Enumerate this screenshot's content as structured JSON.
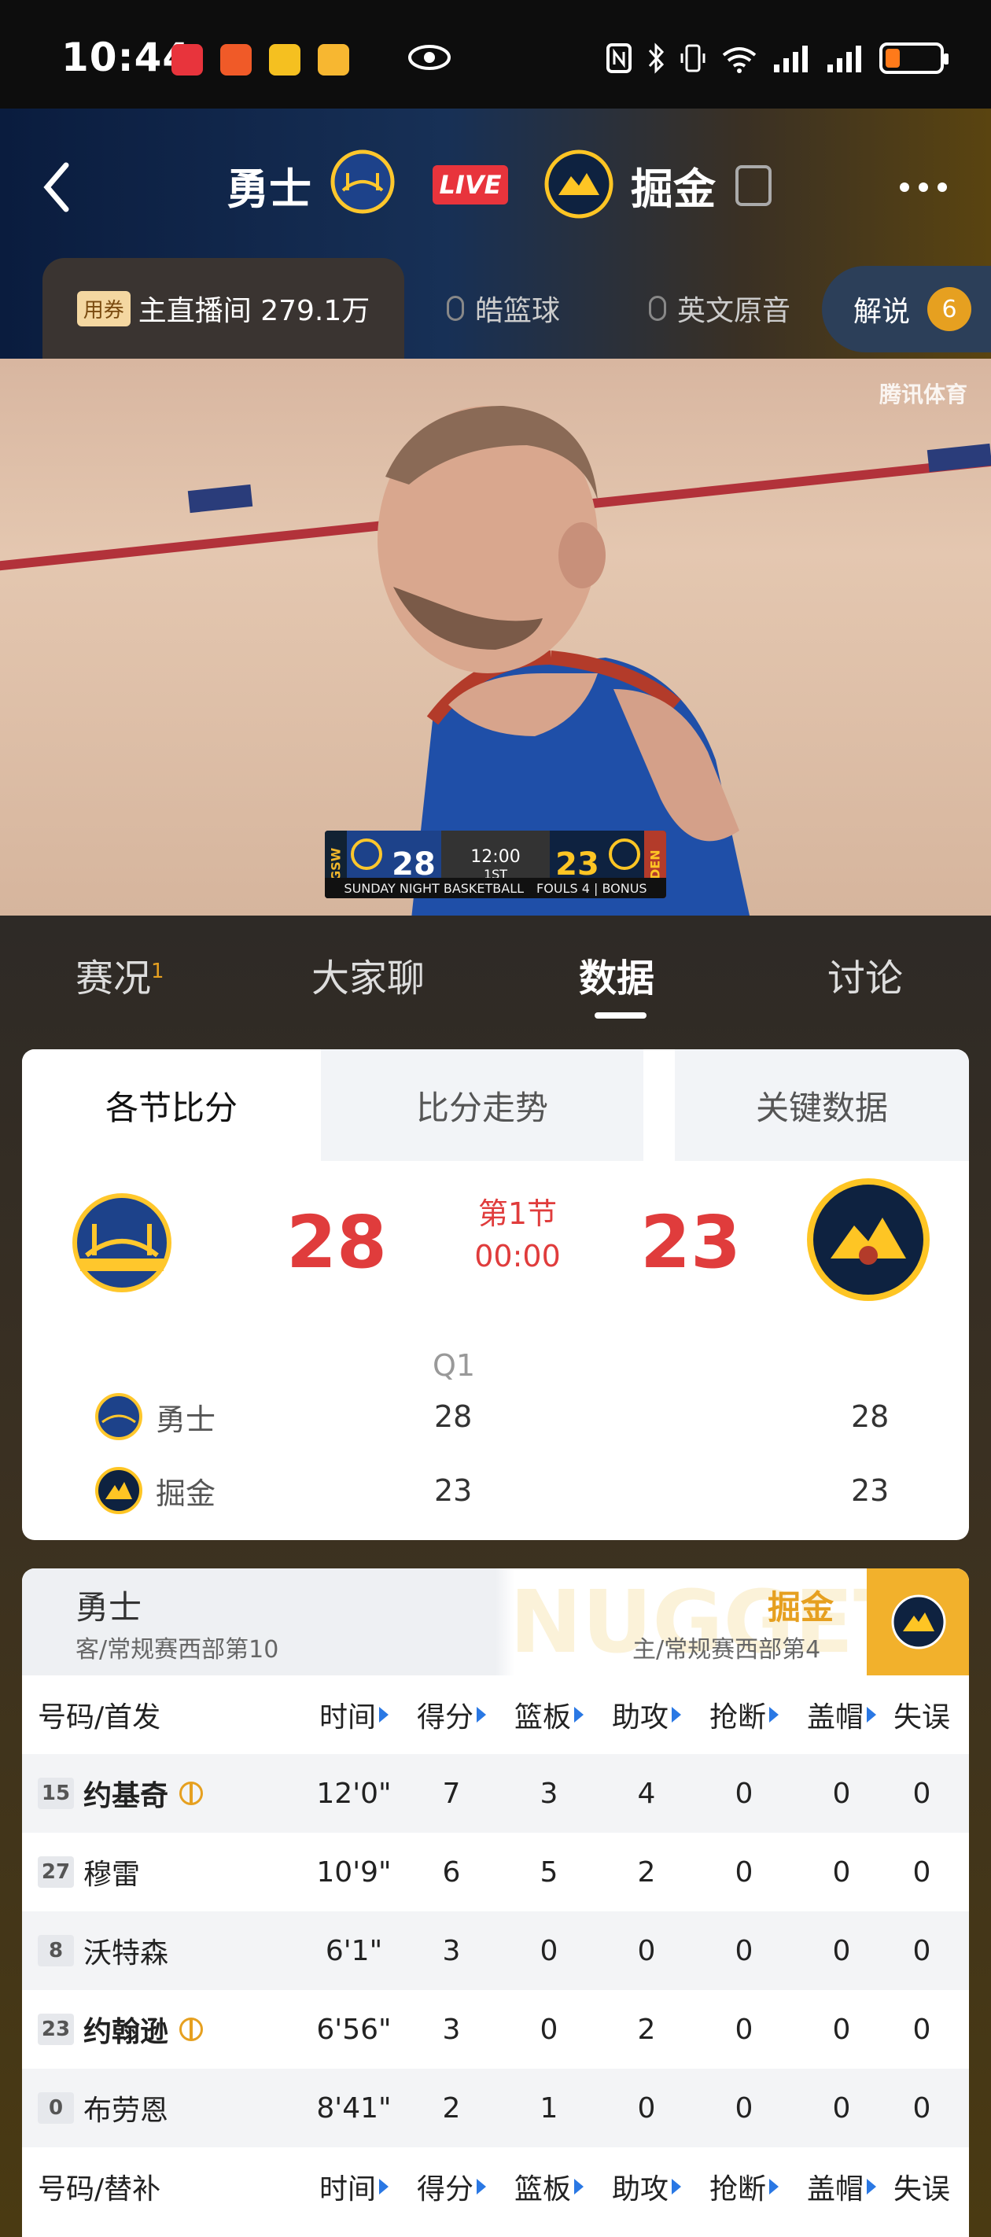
{
  "status_bar": {
    "time": "10:44",
    "battery_color": "#ff7a1a"
  },
  "header": {
    "home_team": "勇士",
    "live_label": "LIVE",
    "away_team": "掘金",
    "streams": [
      {
        "label": "主直播间 279.1万",
        "coupon": "用券"
      },
      {
        "label": "皓篮球"
      },
      {
        "label": "英文原音"
      }
    ],
    "commentary": {
      "label": "解说",
      "count": "6"
    }
  },
  "video": {
    "watermark": "腾讯体育",
    "scorebug": {
      "home_abbr": "GSW",
      "home_score": "28",
      "clock": "12:00",
      "period": "1ST",
      "away_score": "23",
      "away_abbr": "DEN",
      "show_name": "SUNDAY NIGHT BASKETBALL",
      "extra": "FOULS 4 | BONUS"
    }
  },
  "main_tabs": [
    {
      "label": "赛况",
      "badge": "1"
    },
    {
      "label": "大家聊"
    },
    {
      "label": "数据"
    },
    {
      "label": "讨论"
    }
  ],
  "score_card": {
    "tabs": [
      "各节比分",
      "比分走势",
      "关键数据"
    ],
    "home_score": "28",
    "away_score": "23",
    "period_label": "第1节",
    "period_time": "00:00",
    "quarter_header": "Q1",
    "rows": [
      {
        "team": "勇士",
        "q1": "28",
        "total": "28"
      },
      {
        "team": "掘金",
        "q1": "23",
        "total": "23"
      }
    ]
  },
  "stats_card": {
    "home": {
      "name": "勇士",
      "sub": "客/常规赛西部第10"
    },
    "away": {
      "name": "掘金",
      "sub": "主/常规赛西部第4",
      "bg_text": "NUGGETS"
    },
    "columns": [
      "号码/首发",
      "时间",
      "得分",
      "篮板",
      "助攻",
      "抢断",
      "盖帽",
      "失误"
    ],
    "bench_columns": [
      "号码/替补",
      "时间",
      "得分",
      "篮板",
      "助攻",
      "抢断",
      "盖帽",
      "失误"
    ],
    "starters": [
      {
        "num": "15",
        "name": "约基奇",
        "mvp": true,
        "time": "12'0\"",
        "pts": "7",
        "reb": "3",
        "ast": "4",
        "stl": "0",
        "blk": "0",
        "tov": "0"
      },
      {
        "num": "27",
        "name": "穆雷",
        "mvp": false,
        "time": "10'9\"",
        "pts": "6",
        "reb": "5",
        "ast": "2",
        "stl": "0",
        "blk": "0",
        "tov": "0"
      },
      {
        "num": "8",
        "name": "沃特森",
        "mvp": false,
        "time": "6'1\"",
        "pts": "3",
        "reb": "0",
        "ast": "0",
        "stl": "0",
        "blk": "0",
        "tov": "0"
      },
      {
        "num": "23",
        "name": "约翰逊",
        "mvp": true,
        "time": "6'56\"",
        "pts": "3",
        "reb": "0",
        "ast": "2",
        "stl": "0",
        "blk": "0",
        "tov": "0"
      },
      {
        "num": "0",
        "name": "布劳恩",
        "mvp": false,
        "time": "8'41\"",
        "pts": "2",
        "reb": "1",
        "ast": "0",
        "stl": "0",
        "blk": "0",
        "tov": "0"
      }
    ]
  },
  "colors": {
    "accent_red": "#e03c3c",
    "accent_gold": "#e6a020",
    "sort_blue": "#2a78e4",
    "warriors_blue": "#1d428a",
    "warriors_gold": "#ffc72c",
    "nuggets_navy": "#0e2240"
  }
}
